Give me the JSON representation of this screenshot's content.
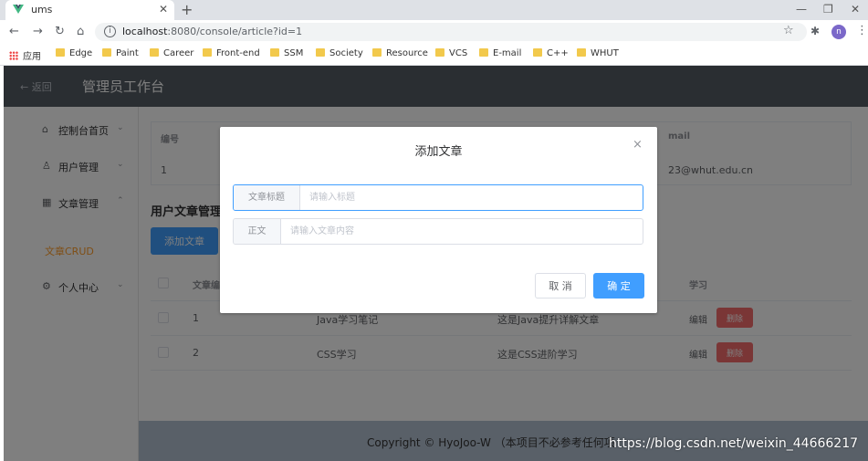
{
  "browser": {
    "tab_title": "ums",
    "url_host": "localhost",
    "url_rest": ":8080/console/article?id=1",
    "profile_initial": "n",
    "bookmarks": [
      "应用",
      "Edge",
      "Paint",
      "Career",
      "Front-end",
      "SSM",
      "Society",
      "Resource",
      "VCS",
      "E-mail",
      "C++",
      "WHUT"
    ]
  },
  "app": {
    "back_label": "← 返回",
    "title": "管理员工作台",
    "sidebar": {
      "items": [
        {
          "icon": "home-icon",
          "label": "控制台首页"
        },
        {
          "icon": "user-icon",
          "label": "用户管理"
        },
        {
          "icon": "grid-icon",
          "label": "文章管理"
        },
        {
          "icon": "settings-icon",
          "label": "个人中心"
        }
      ],
      "sub_item": "文章CRUD"
    },
    "info_table": {
      "headers": [
        "编号",
        "mail"
      ],
      "row": [
        "1",
        "23@whut.edu.cn"
      ]
    },
    "section_title": "用户文章管理",
    "add_button": "添加文章",
    "article_table": {
      "headers": [
        "文章编",
        "学习"
      ],
      "rows": [
        {
          "id": "1",
          "title": "Java学习笔记",
          "summary": "这是Java提升详解文章",
          "edit": "编辑",
          "delete": "删除"
        },
        {
          "id": "2",
          "title": "CSS学习",
          "summary": "这是CSS进阶学习",
          "edit": "编辑",
          "delete": "删除"
        }
      ]
    },
    "footer": "Copyright © HyoJoo-W （本项目不必参考任何项"
  },
  "dialog": {
    "title": "添加文章",
    "close": "×",
    "title_field": {
      "label": "文章标题",
      "placeholder": "请输入标题"
    },
    "content_field": {
      "label": "正文",
      "placeholder": "请输入文章内容"
    },
    "cancel": "取 消",
    "confirm": "确 定"
  },
  "watermark": "https://blog.csdn.net/weixin_44666217"
}
